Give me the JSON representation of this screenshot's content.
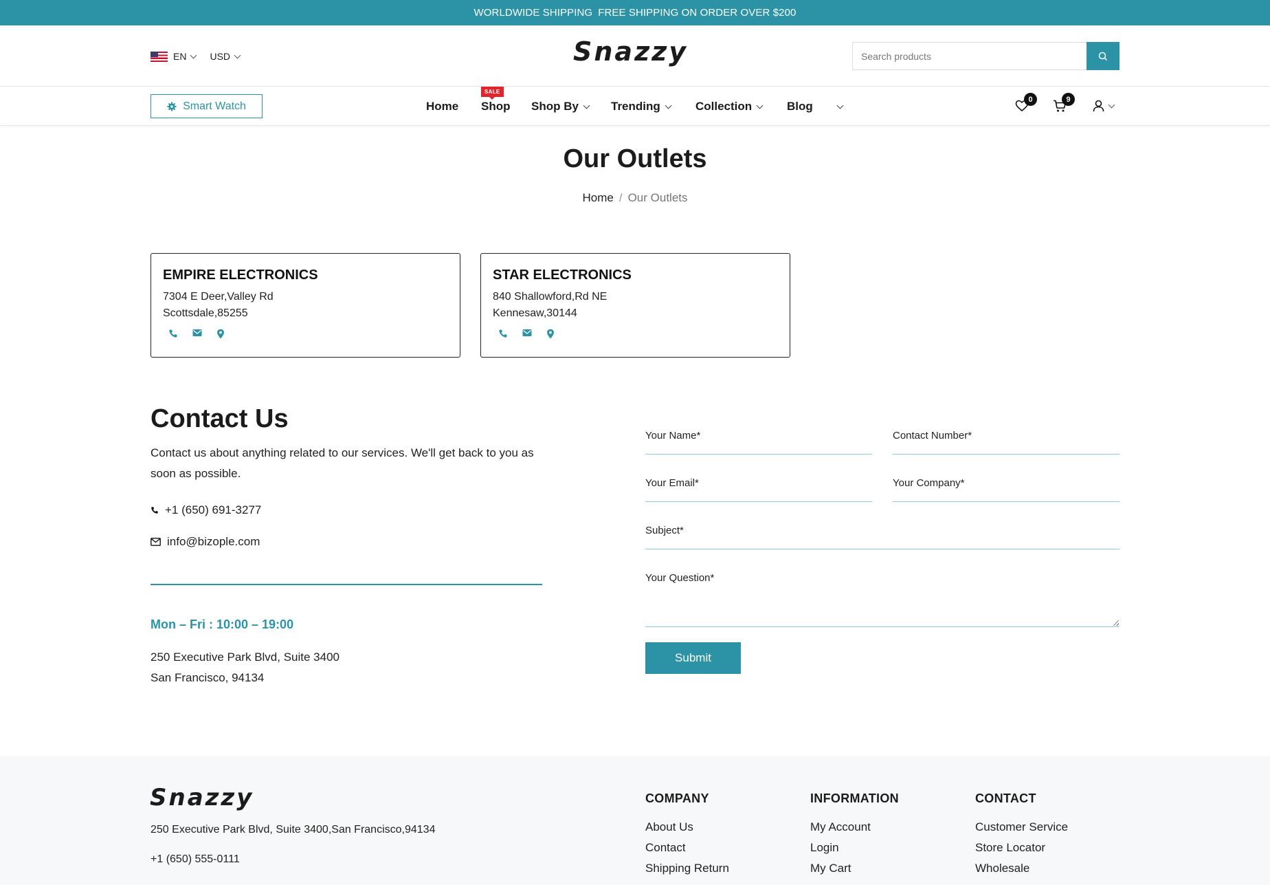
{
  "topbar": {
    "part1": "WORLDWIDE SHIPPING",
    "part2": "FREE SHIPPING ON ORDER OVER $200"
  },
  "header": {
    "language": "EN",
    "currency": "USD",
    "logo": "Snazzy",
    "search_placeholder": "Search products"
  },
  "nav": {
    "category_button": "Smart Watch",
    "items": [
      "Home",
      "Shop",
      "Shop By",
      "Trending",
      "Collection",
      "Blog"
    ],
    "sale_badge": "SALE",
    "wishlist_count": "0",
    "cart_count": "9"
  },
  "page": {
    "title": "Our Outlets",
    "breadcrumb_home": "Home",
    "breadcrumb_sep": "/",
    "breadcrumb_current": "Our Outlets"
  },
  "outlets": [
    {
      "name": "EMPIRE ELECTRONICS",
      "line1": "7304 E Deer,Valley Rd",
      "line2": "Scottsdale,85255"
    },
    {
      "name": "STAR ELECTRONICS",
      "line1": "840 Shallowford,Rd NE",
      "line2": "Kennesaw,30144"
    }
  ],
  "contact": {
    "title": "Contact Us",
    "description": "Contact us about anything related to our services. We'll get back to you as soon as possible.",
    "phone": "+1 (650) 691-3277",
    "email": "info@bizople.com",
    "hours": "Mon – Fri : 10:00 – 19:00",
    "address1": "250 Executive Park Blvd, Suite 3400",
    "address2": "San Francisco, 94134"
  },
  "form": {
    "name": "Your Name*",
    "contact_number": "Contact Number*",
    "email": "Your Email*",
    "company": "Your Company*",
    "subject": "Subject*",
    "question": "Your Question*",
    "submit": "Submit"
  },
  "footer": {
    "logo": "Snazzy",
    "address": "250 Executive Park Blvd, Suite 3400,San Francisco,94134",
    "phone": "+1 (650) 555-0111",
    "columns": [
      {
        "title": "COMPANY",
        "links": [
          "About Us",
          "Contact",
          "Shipping Return"
        ]
      },
      {
        "title": "INFORMATION",
        "links": [
          "My Account",
          "Login",
          "My Cart"
        ]
      },
      {
        "title": "CONTACT",
        "links": [
          "Customer Service",
          "Store Locator",
          "Wholesale"
        ]
      }
    ]
  },
  "colors": {
    "accent": "#2b93a5",
    "sale": "#e0262d",
    "footer_bg": "#f7f8f9"
  }
}
